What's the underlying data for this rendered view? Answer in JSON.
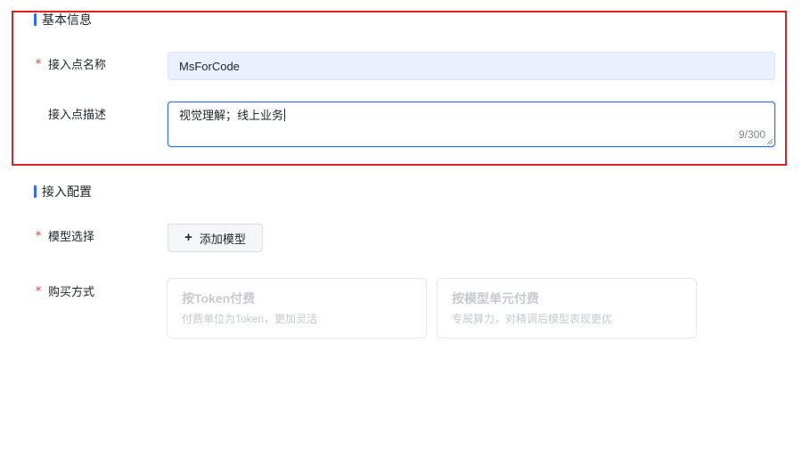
{
  "basic_info": {
    "section_title": "基本信息",
    "name_field": {
      "label": "接入点名称",
      "required_mark": "*",
      "value": "MsForCode"
    },
    "desc_field": {
      "label": "接入点描述",
      "value": "视觉理解；线上业务",
      "counter": "9/300"
    }
  },
  "access_config": {
    "section_title": "接入配置",
    "model_select": {
      "label": "模型选择",
      "required_mark": "*",
      "button_icon": "+",
      "button_label": "添加模型"
    },
    "purchase": {
      "label": "购买方式",
      "required_mark": "*",
      "options": [
        {
          "title": "按Token付费",
          "desc": "付费单位为Token，更加灵活"
        },
        {
          "title": "按模型单元付费",
          "desc": "专属算力，对精调后模型表现更优"
        }
      ]
    }
  },
  "colors": {
    "accent": "#2f6bff",
    "required": "#e53935",
    "highlight_frame": "#e02020",
    "input_bg": "#eaf1fd"
  }
}
